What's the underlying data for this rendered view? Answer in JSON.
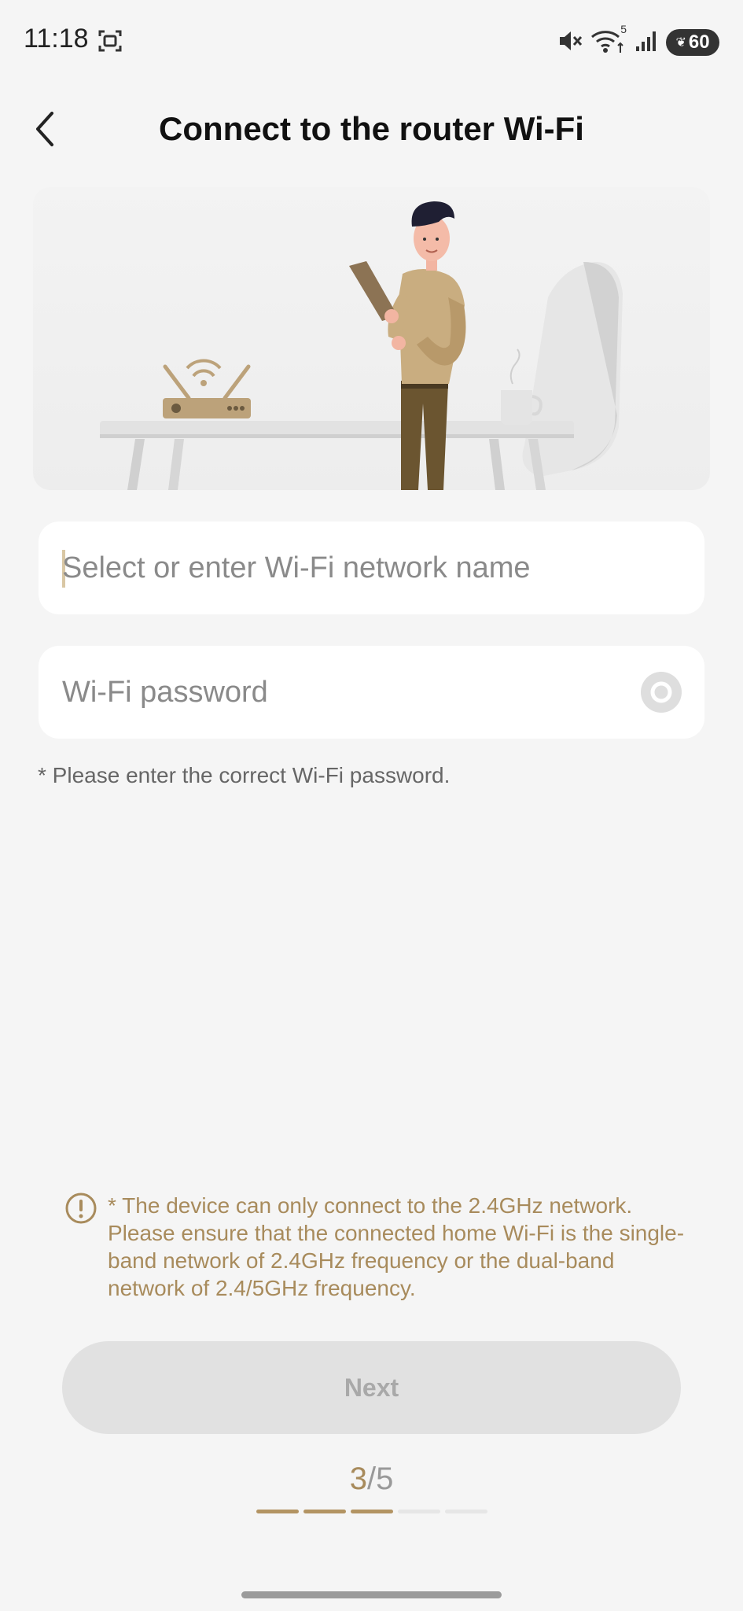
{
  "status_bar": {
    "time": "11:18",
    "battery": "60",
    "wifi_badge": "5",
    "icons": [
      "screen-record-icon",
      "mute-icon",
      "wifi-icon",
      "signal-icon",
      "battery-icon"
    ]
  },
  "header": {
    "title": "Connect to the router Wi-Fi",
    "back_icon": "chevron-left-icon"
  },
  "form": {
    "ssid_placeholder": "Select or enter Wi-Fi network name",
    "ssid_value": "",
    "password_placeholder": "Wi-Fi password",
    "password_value": "",
    "eye_icon": "eye-icon",
    "hint": "* Please enter the correct Wi-Fi password."
  },
  "notice": {
    "icon": "exclamation-circle-icon",
    "text": "* The device can only connect to the 2.4GHz network. Please ensure that the connected home Wi-Fi is the single-band network of 2.4GHz frequency or the dual-band network of 2.4/5GHz frequency."
  },
  "next_button": {
    "label": "Next",
    "enabled": false
  },
  "steps": {
    "current": "3",
    "separator": "/",
    "total": "5",
    "completed": 3,
    "count": 5
  },
  "colors": {
    "accent": "#a88b5c",
    "background": "#f5f5f5",
    "button_disabled": "#e1e1e1",
    "button_text_disabled": "#a9a9a9"
  }
}
